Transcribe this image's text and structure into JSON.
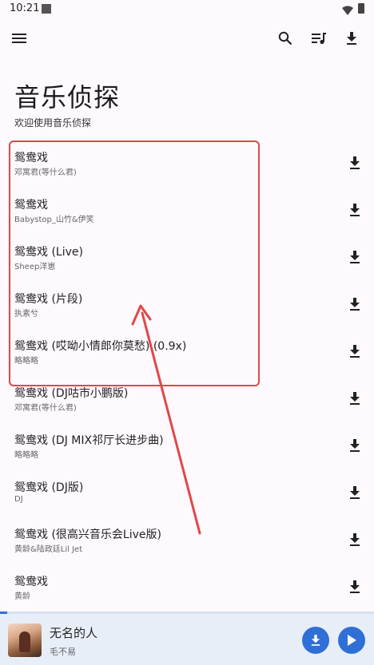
{
  "status": {
    "time": "10:21"
  },
  "header": {
    "title": "音乐侦探",
    "subtitle": "欢迎使用音乐侦探"
  },
  "songs": [
    {
      "title": "鸳鸯戏",
      "artist": "邓寓君(等什么君)"
    },
    {
      "title": "鸳鸯戏",
      "artist": "Babystop_山竹&伊笑"
    },
    {
      "title": "鸳鸯戏 (Live)",
      "artist": "Sheep洋崽"
    },
    {
      "title": "鸳鸯戏 (片段)",
      "artist": "执素兮"
    },
    {
      "title": "鸳鸯戏 (哎呦小情郎你莫愁) (0.9x)",
      "artist": "略略略"
    },
    {
      "title": "鸳鸯戏 (DJ咕市小鹏版)",
      "artist": "邓寓君(等什么君)"
    },
    {
      "title": "鸳鸯戏 (DJ MIX祁厅长进步曲)",
      "artist": "略略略"
    },
    {
      "title": "鸳鸯戏 (DJ版)",
      "artist": "DJ"
    },
    {
      "title": "鸳鸯戏 (很高兴音乐会Live版)",
      "artist": "黄龄&陆政廷Lil Jet"
    },
    {
      "title": "鸳鸯戏",
      "artist": "黄龄"
    }
  ],
  "player": {
    "title": "无名的人",
    "artist": "毛不易",
    "progress_fraction": 0.02
  },
  "colors": {
    "accent": "#2f6fd6",
    "annotation": "#e04848",
    "background": "#fdf9fd"
  },
  "icons": [
    "menu-icon",
    "search-icon",
    "playlist-icon",
    "download-icon",
    "play-icon"
  ]
}
